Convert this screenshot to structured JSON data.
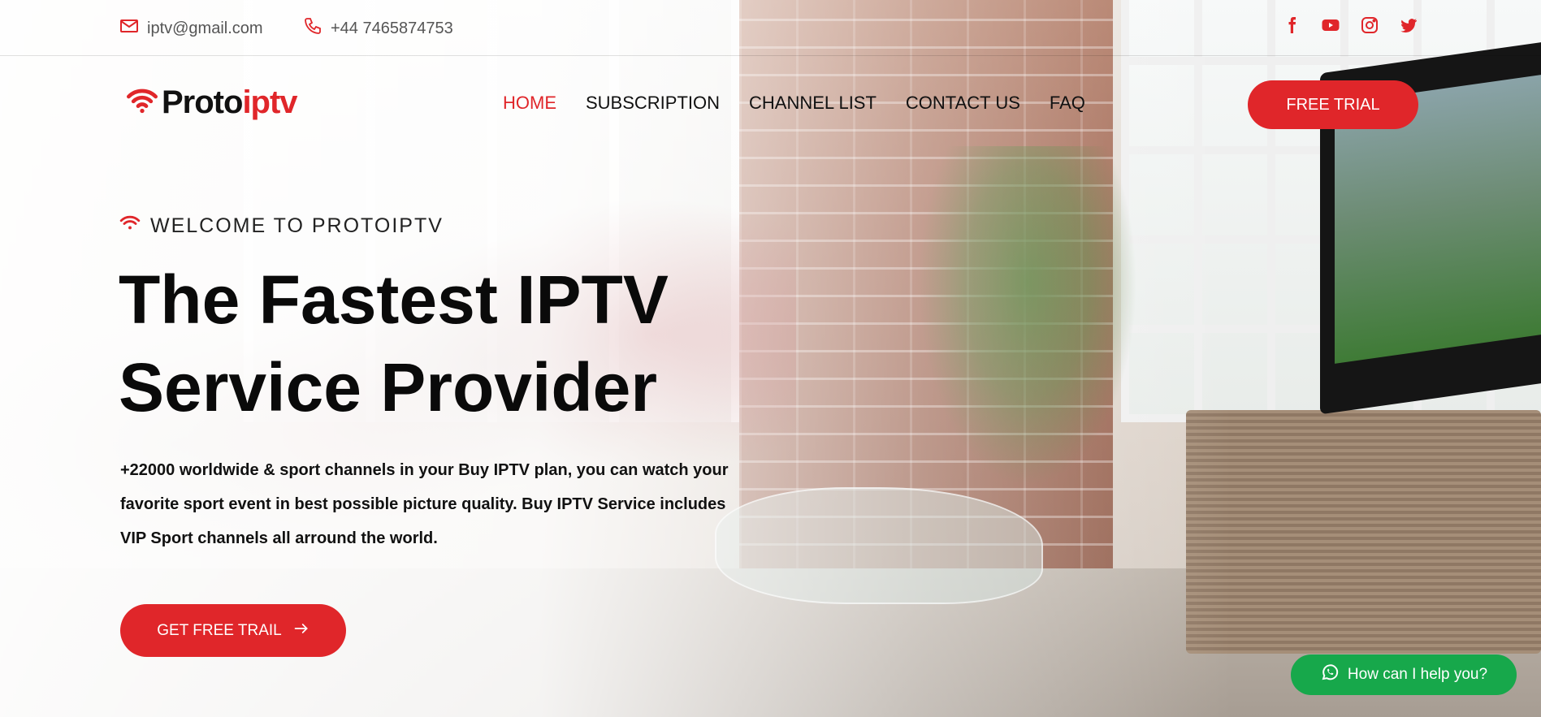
{
  "topbar": {
    "email": "iptv@gmail.com",
    "phone": "+44 7465874753",
    "social": [
      "facebook-icon",
      "youtube-icon",
      "instagram-icon",
      "twitter-icon"
    ]
  },
  "brand": {
    "part1": "Proto",
    "part2": "iptv"
  },
  "nav": {
    "items": [
      {
        "label": "HOME",
        "active": true
      },
      {
        "label": "SUBSCRIPTION"
      },
      {
        "label": "CHANNEL LIST"
      },
      {
        "label": "CONTACT US"
      },
      {
        "label": "FAQ"
      }
    ]
  },
  "header": {
    "trial_label": "FREE TRIAL"
  },
  "hero": {
    "eyebrow": "WELCOME TO PROTOIPTV",
    "title_line1": "The Fastest IPTV",
    "title_line2": "Service Provider",
    "desc_line1": "+22000 worldwide & sport channels in your Buy IPTV plan, you can watch your",
    "desc_line2": "favorite sport event in best possible picture quality. Buy IPTV Service includes",
    "desc_line3": "VIP Sport channels all arround the world.",
    "cta_label": "GET FREE TRAIL"
  },
  "chat": {
    "label": "How can I help you?"
  },
  "colors": {
    "accent": "#e0262a",
    "whatsapp": "#17a84b",
    "text": "#0a0a0a"
  }
}
